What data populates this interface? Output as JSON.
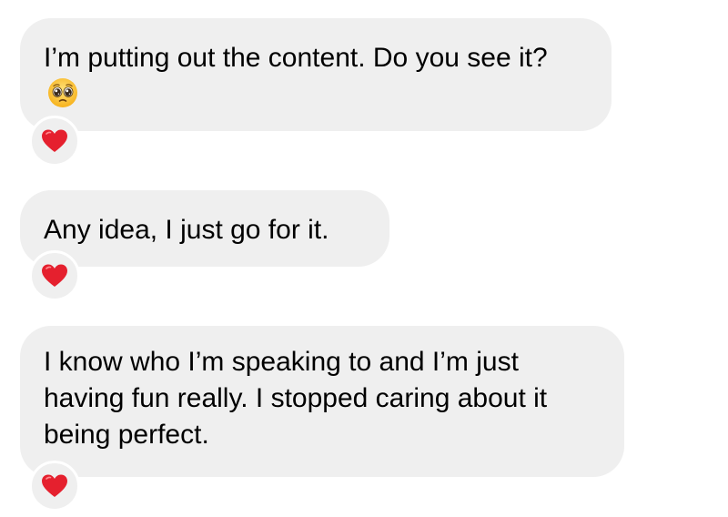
{
  "messages": [
    {
      "text": "I’m putting out the content. Do you see it?",
      "emoji": "pleading-face-icon",
      "reaction": "red-heart-icon"
    },
    {
      "text": "Any idea, I just go for it.",
      "reaction": "red-heart-icon"
    },
    {
      "text": "I know who I’m speaking to and I’m just having fun really. I stopped caring about it being perfect.",
      "reaction": "red-heart-icon"
    }
  ],
  "colors": {
    "bubble_background": "#efefef",
    "text": "#000000",
    "heart": "#e5202e",
    "page_background": "#ffffff"
  }
}
